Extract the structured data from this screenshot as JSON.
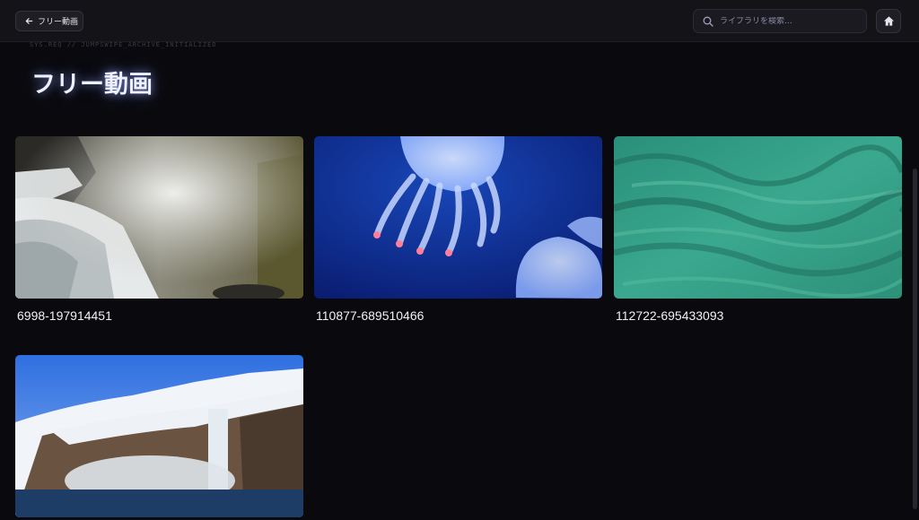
{
  "header": {
    "back_label": "フリー動画",
    "search_placeholder": "ライブラリを検索...",
    "home_icon": "home-icon",
    "search_icon": "search-icon",
    "back_icon": "arrow-left-icon"
  },
  "system_line": "SYS.REQ // JUMPSWIPE_ARCHIVE_INITIALIZED",
  "page_title": "フリー動画",
  "videos": [
    {
      "title": "6998-197914451"
    },
    {
      "title": "110877-689510466"
    },
    {
      "title": "112722-695433093"
    },
    {
      "title": ""
    }
  ],
  "colors": {
    "background": "#0a0a0e",
    "topbar": "#141418",
    "title_glow": "#96aaff"
  }
}
